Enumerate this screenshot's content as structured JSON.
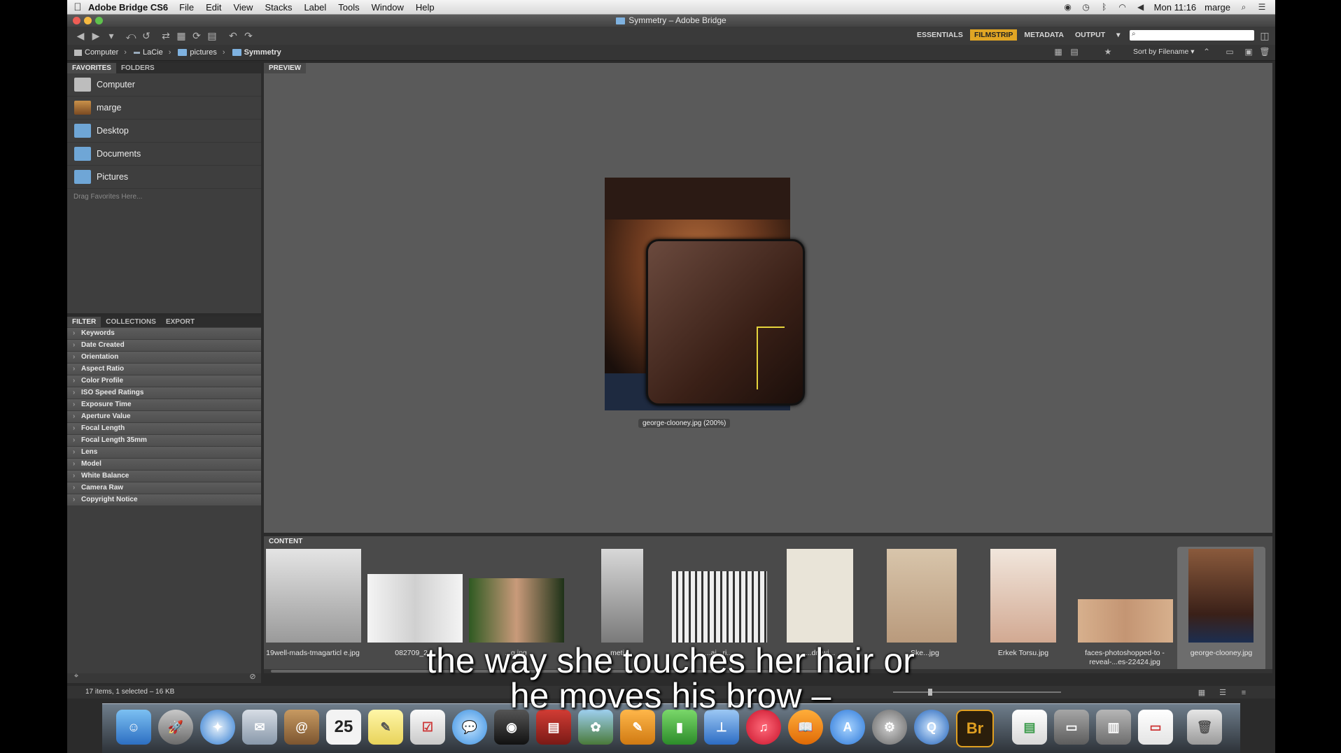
{
  "menubar": {
    "app_name": "Adobe Bridge CS6",
    "menus": [
      "File",
      "Edit",
      "View",
      "Stacks",
      "Label",
      "Tools",
      "Window",
      "Help"
    ],
    "clock": "Mon 11:16",
    "user": "marge"
  },
  "window": {
    "title": "Symmetry – Adobe Bridge"
  },
  "workspaces": {
    "items": [
      "ESSENTIALS",
      "FILMSTRIP",
      "METADATA",
      "OUTPUT"
    ],
    "active": "FILMSTRIP"
  },
  "search": {
    "placeholder": ""
  },
  "path": {
    "items": [
      "Computer",
      "LaCie",
      "pictures",
      "Symmetry"
    ]
  },
  "sort": {
    "label": "Sort by Filename"
  },
  "left_tabs": [
    "FAVORITES",
    "FOLDERS"
  ],
  "favorites": [
    {
      "label": "Computer",
      "icon": "computer-icon"
    },
    {
      "label": "marge",
      "icon": "home-icon"
    },
    {
      "label": "Desktop",
      "icon": "folder-icon"
    },
    {
      "label": "Documents",
      "icon": "folder-icon"
    },
    {
      "label": "Pictures",
      "icon": "folder-icon"
    }
  ],
  "favorites_hint": "Drag Favorites Here...",
  "filter_tabs": [
    "FILTER",
    "COLLECTIONS",
    "EXPORT"
  ],
  "filters": [
    "Keywords",
    "Date Created",
    "Orientation",
    "Aspect Ratio",
    "Color Profile",
    "ISO Speed Ratings",
    "Exposure Time",
    "Aperture Value",
    "Focal Length",
    "Focal Length 35mm",
    "Lens",
    "Model",
    "White Balance",
    "Camera Raw",
    "Copyright Notice"
  ],
  "preview": {
    "tab": "PREVIEW",
    "caption": "george-clooney.jpg (200%)"
  },
  "content": {
    "tab": "CONTENT",
    "items": [
      {
        "label": "19well-mads-tmagarticl e.jpg"
      },
      {
        "label": "082709_2..."
      },
      {
        "label": "...g.jpg"
      },
      {
        "label": "...meti..."
      },
      {
        "label": "...ai...ri..."
      },
      {
        "label": "...drawi..."
      },
      {
        "label": "...Ske...jpg"
      },
      {
        "label": "Erkek Torsu.jpg"
      },
      {
        "label": "faces-photoshopped-to -reveal-...es-22424.jpg"
      },
      {
        "label": "george-clooney.jpg"
      }
    ]
  },
  "status": {
    "text": "17 items, 1 selected – 16 KB"
  },
  "dock": {
    "items": [
      "finder-icon",
      "launchpad-icon",
      "safari-icon",
      "mail-icon",
      "contacts-icon",
      "calendar-icon",
      "notes-icon",
      "reminders-icon",
      "messages-icon",
      "facetime-icon",
      "photo-booth-icon",
      "iphoto-icon",
      "pages-icon",
      "numbers-icon",
      "keynote-icon",
      "itunes-icon",
      "ibooks-icon",
      "app-store-icon",
      "system-preferences-icon",
      "quicktime-icon",
      "bridge-icon",
      "document-icon",
      "downloads-icon",
      "documents-stack-icon",
      "trash-icon"
    ],
    "calendar_day": "25",
    "bridge_label": "Br"
  },
  "subtitles": {
    "line1": "the way she touches her hair or",
    "line2": "he moves his brow –"
  }
}
